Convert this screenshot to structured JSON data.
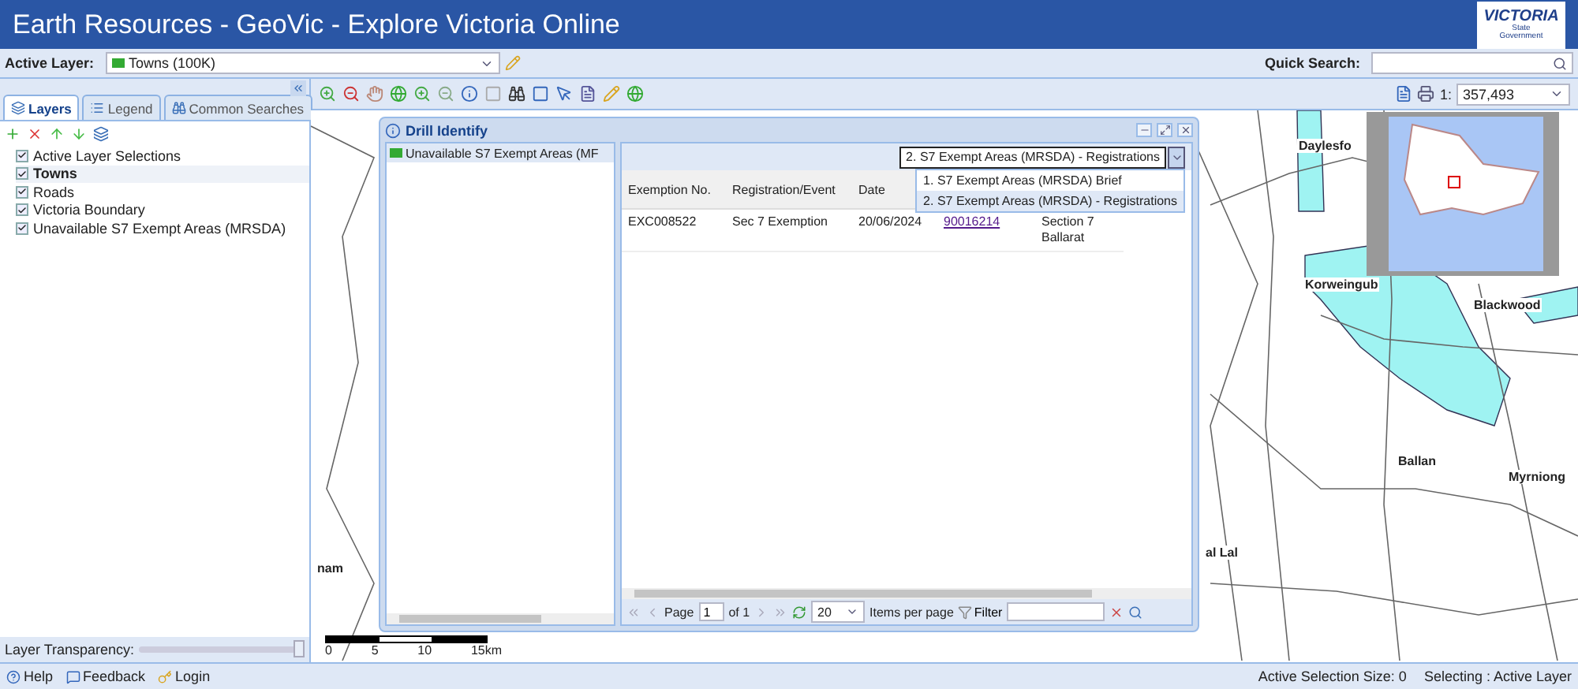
{
  "window": {
    "title": "Earth Resources - GeoVic - Explore Victoria Online"
  },
  "logo": {
    "name": "VICTORIA",
    "lines": [
      "State",
      "Government"
    ]
  },
  "active_layer": {
    "label": "Active Layer:",
    "value": "Towns (100K)"
  },
  "quick_search": {
    "label": "Quick Search:"
  },
  "scale": {
    "prefix": "1:",
    "value": "357,493"
  },
  "sidebar": {
    "tabs": [
      {
        "label": "Layers",
        "selected": true
      },
      {
        "label": "Legend",
        "selected": false
      },
      {
        "label": "Common Searches",
        "selected": false
      }
    ],
    "layers": [
      {
        "label": "Active Layer Selections",
        "checked": true,
        "selected": false
      },
      {
        "label": "Towns",
        "checked": true,
        "selected": true
      },
      {
        "label": "Roads",
        "checked": true,
        "selected": false
      },
      {
        "label": "Victoria Boundary",
        "checked": true,
        "selected": false
      },
      {
        "label": "Unavailable S7 Exempt Areas (MRSDA)",
        "checked": true,
        "selected": false
      }
    ],
    "transparency": {
      "label": "Layer Transparency:",
      "level": 1
    }
  },
  "map": {
    "labels": [
      {
        "text": "Daylesfo"
      },
      {
        "text": "Korweingub"
      },
      {
        "text": "Blackwood"
      },
      {
        "text": "Ballan"
      },
      {
        "text": "Myrniong"
      },
      {
        "text": "al Lal"
      },
      {
        "text": "nam"
      }
    ],
    "scale_bar": [
      "0",
      "5",
      "10",
      "15km"
    ]
  },
  "drill_identify": {
    "title": "Drill Identify",
    "tree_items": [
      {
        "label": "Unavailable S7 Exempt Areas (MF",
        "selected": true
      }
    ],
    "result_select": {
      "value": "2. S7 Exempt Areas (MRSDA) - Registrations",
      "expanded": true,
      "options": [
        {
          "label": "1. S7 Exempt Areas (MRSDA) Brief",
          "selected": false
        },
        {
          "label": "2. S7 Exempt Areas (MRSDA) - Registrations",
          "selected": true
        }
      ]
    },
    "table": {
      "columns": [
        "Exemption No.",
        "Registration/Event",
        "Date"
      ],
      "rows": [
        {
          "cells": [
            {
              "kind": "text",
              "text": "EXC008522"
            },
            {
              "kind": "text",
              "text": "Sec 7 Exemption"
            },
            {
              "kind": "text",
              "text": "20/06/2024"
            },
            {
              "kind": "link",
              "text": "90016214"
            },
            {
              "kind": "text",
              "text": "Section 7 Ballarat"
            }
          ]
        }
      ]
    },
    "pager": {
      "page_label": "Page",
      "page": "1",
      "of": "of 1",
      "page_size": "20",
      "items_per_page": "Items per page",
      "filter": "Filter"
    }
  },
  "status_bar": {
    "links": [
      "Help",
      "Feedback",
      "Login"
    ],
    "selection_size": "Active Selection Size: 0",
    "selecting": "Selecting : Active Layer"
  }
}
